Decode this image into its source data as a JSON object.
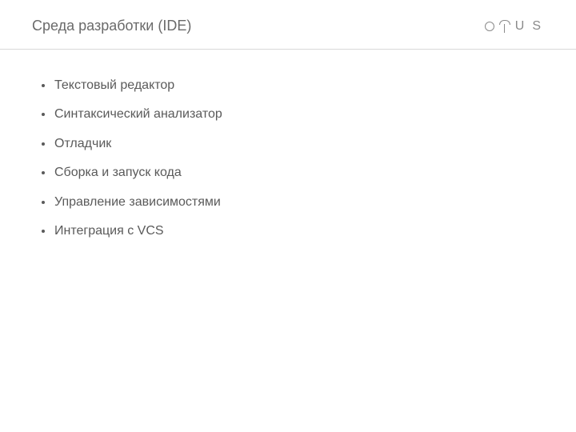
{
  "header": {
    "title": "Среда разработки (IDE)",
    "brand_u": "U",
    "brand_s": "S"
  },
  "bullets": [
    "Текстовый редактор",
    "Синтаксический анализатор",
    "Отладчик",
    "Сборка и запуск кода",
    "Управление зависимостями",
    "Интеграция с VCS"
  ]
}
